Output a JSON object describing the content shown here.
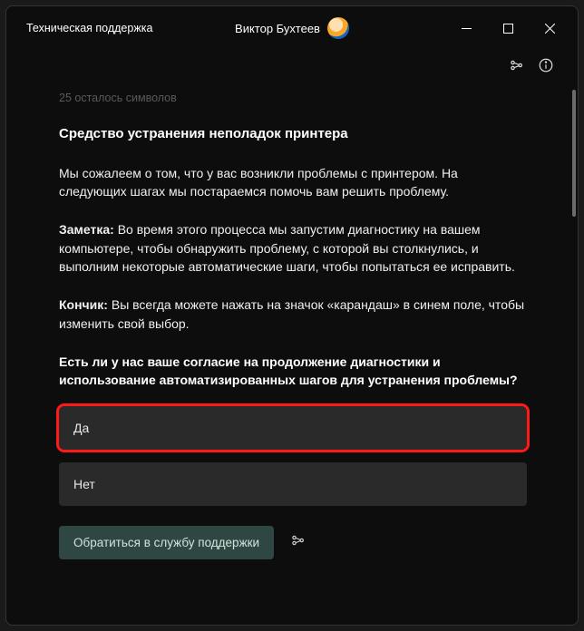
{
  "titlebar": {
    "app_title": "Техническая поддержка",
    "user_name": "Виктор Бухтеев"
  },
  "content": {
    "faded_line": "25 осталось символов",
    "heading": "Средство устранения неполадок принтера",
    "intro": "Мы сожалеем о том, что у вас возникли проблемы с принтером. На следующих шагах мы постараемся помочь вам решить проблему.",
    "note_label": "Заметка:",
    "note_text": " Во время этого процесса мы запустим диагностику на вашем компьютере, чтобы обнаружить проблему, с которой вы столкнулись, и выполним некоторые автоматические шаги, чтобы попытаться ее исправить.",
    "tip_label": "Кончик:",
    "tip_text": " Вы всегда можете нажать на значок «карандаш» в синем поле, чтобы изменить свой выбор.",
    "question": "Есть ли у нас ваше согласие на продолжение диагностики и использование автоматизированных шагов для устранения проблемы?",
    "option_yes": "Да",
    "option_no": "Нет",
    "support_button": "Обратиться в службу поддержки"
  }
}
